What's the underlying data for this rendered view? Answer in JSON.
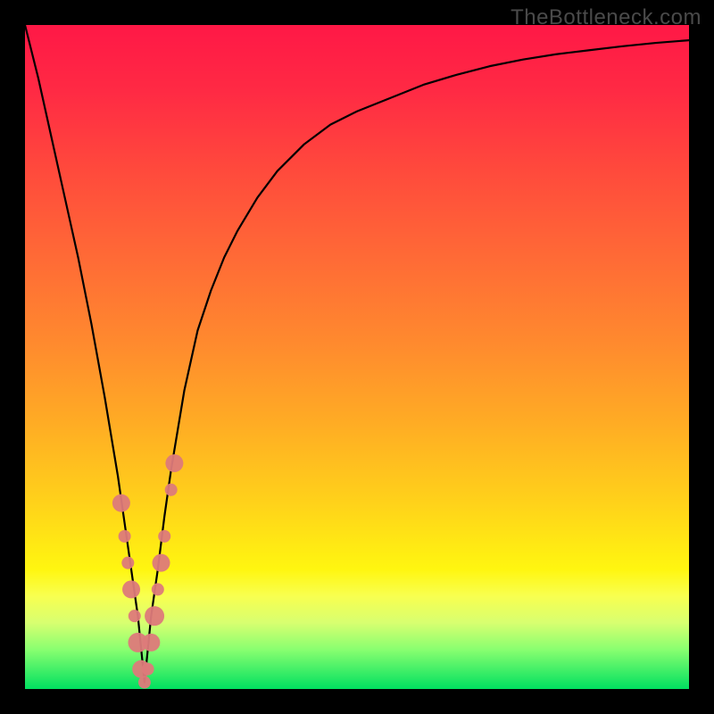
{
  "watermark": "TheBottleneck.com",
  "chart_data": {
    "type": "line",
    "title": "",
    "xlabel": "",
    "ylabel": "",
    "xlim": [
      0,
      100
    ],
    "ylim": [
      0,
      100
    ],
    "x": [
      0,
      2,
      4,
      6,
      8,
      10,
      12,
      14,
      15,
      16,
      17,
      17.5,
      18,
      18.5,
      19,
      20,
      21,
      22,
      23,
      24,
      26,
      28,
      30,
      32,
      35,
      38,
      42,
      46,
      50,
      55,
      60,
      65,
      70,
      75,
      80,
      85,
      90,
      95,
      100
    ],
    "series": [
      {
        "name": "bottleneck-curve",
        "values": [
          100,
          92,
          83,
          74,
          65,
          55,
          44,
          32,
          25,
          18,
          11,
          6,
          1,
          6,
          11,
          18,
          26,
          33,
          39,
          45,
          54,
          60,
          65,
          69,
          74,
          78,
          82,
          85,
          87,
          89,
          91,
          92.5,
          93.8,
          94.8,
          95.6,
          96.2,
          96.8,
          97.3,
          97.7
        ]
      }
    ],
    "markers": {
      "name": "highlight-beads",
      "x": [
        14.5,
        15,
        15.5,
        16,
        16.5,
        17,
        17.5,
        18,
        18.5,
        19,
        19.5,
        20,
        20.5,
        21,
        22,
        22.5
      ],
      "y": [
        28,
        23,
        19,
        15,
        11,
        7,
        3,
        1,
        3,
        7,
        11,
        15,
        19,
        23,
        30,
        34
      ]
    },
    "gradient_stops": [
      {
        "pos": 0.0,
        "color": "#ff1846"
      },
      {
        "pos": 0.35,
        "color": "#ff6a36"
      },
      {
        "pos": 0.72,
        "color": "#ffd21a"
      },
      {
        "pos": 0.86,
        "color": "#f8ff50"
      },
      {
        "pos": 1.0,
        "color": "#00e060"
      }
    ]
  }
}
